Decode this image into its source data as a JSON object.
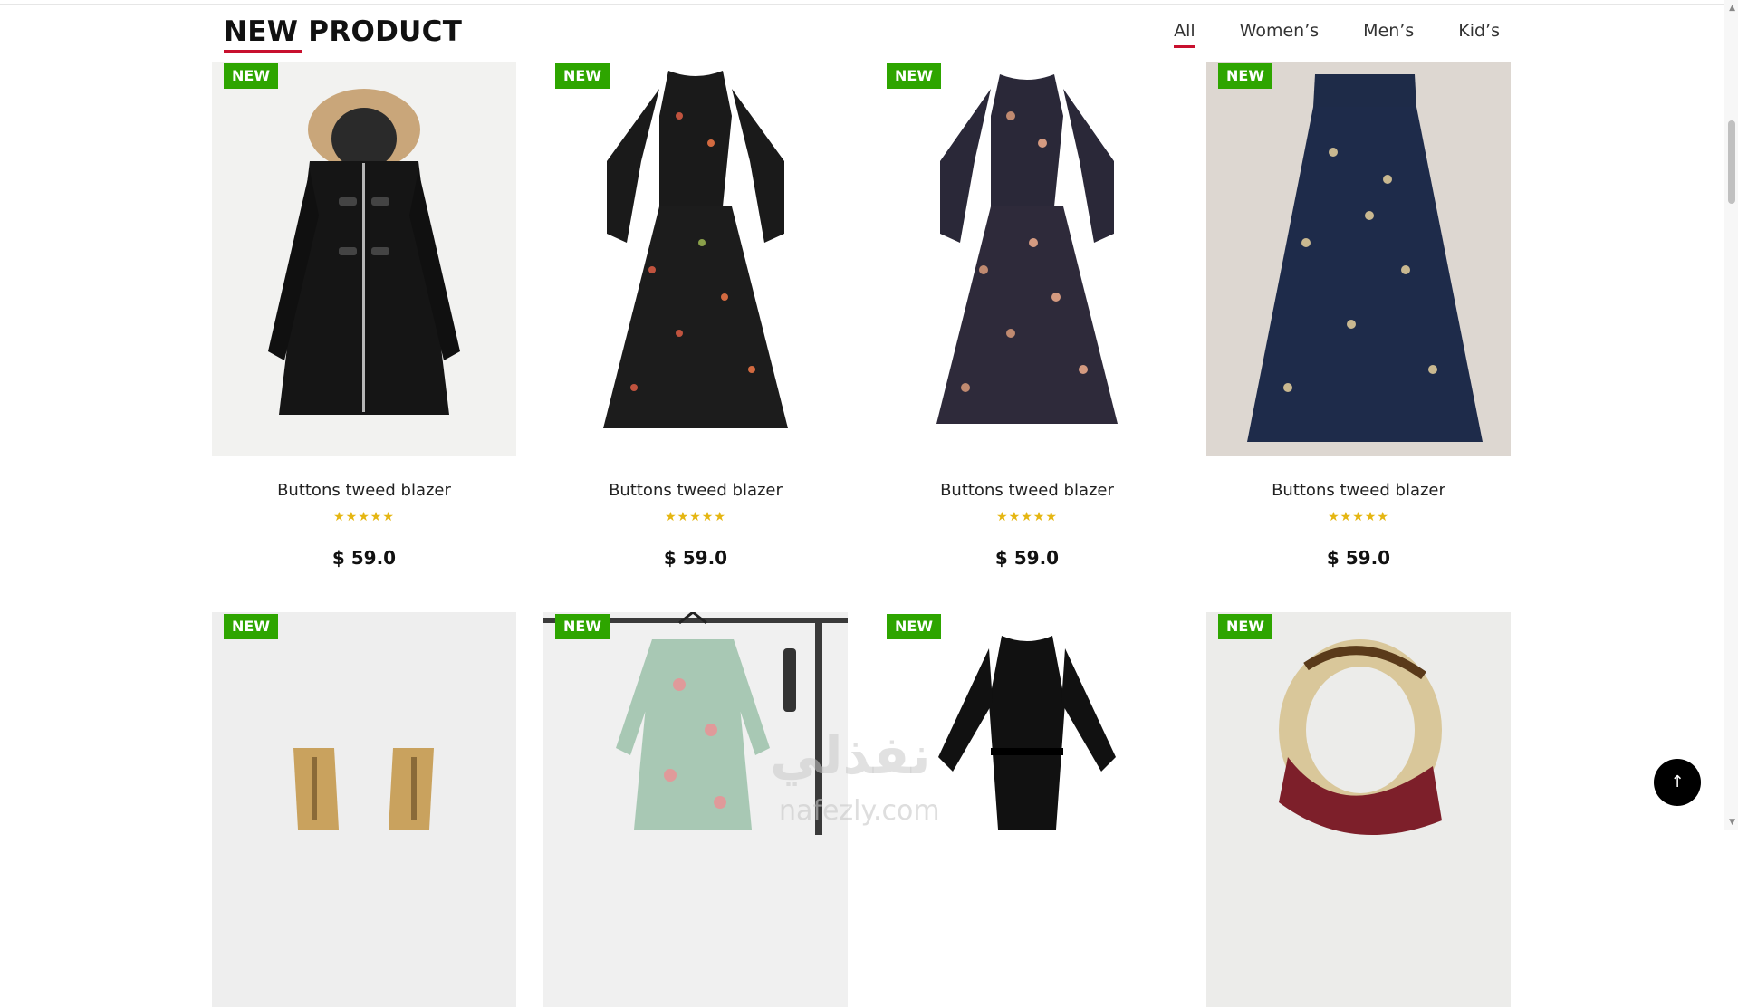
{
  "section": {
    "title": "NEW PRODUCT"
  },
  "tabs": [
    {
      "label": "All",
      "active": true
    },
    {
      "label": "Women’s",
      "active": false
    },
    {
      "label": "Men’s",
      "active": false
    },
    {
      "label": "Kid’s",
      "active": false
    }
  ],
  "products_row1": [
    {
      "badge": "NEW",
      "name": "Buttons tweed blazer",
      "rating": 5,
      "price": "$ 59.0",
      "image": "black-hooded-coat"
    },
    {
      "badge": "NEW",
      "name": "Buttons tweed blazer",
      "rating": 5,
      "price": "$ 59.0",
      "image": "black-floral-dress"
    },
    {
      "badge": "NEW",
      "name": "Buttons tweed blazer",
      "rating": 5,
      "price": "$ 59.0",
      "image": "navy-floral-dress"
    },
    {
      "badge": "NEW",
      "name": "Buttons tweed blazer",
      "rating": 5,
      "price": "$ 59.0",
      "image": "navy-floral-skirt"
    }
  ],
  "products_row2": [
    {
      "badge": "NEW",
      "image": "tan-lace-up-boots"
    },
    {
      "badge": "NEW",
      "image": "mint-floral-dress-on-rack"
    },
    {
      "badge": "NEW",
      "image": "black-belted-dress"
    },
    {
      "badge": "NEW",
      "image": "printed-silk-scarf"
    }
  ],
  "watermark": {
    "text": "نفذلي",
    "sub": "nafezly.com"
  },
  "icons": {
    "star": "star-icon",
    "back_to_top": "arrow-up-icon"
  },
  "colors": {
    "accent": "#c8102e",
    "badge": "#2ea500",
    "star": "#e5b612"
  }
}
